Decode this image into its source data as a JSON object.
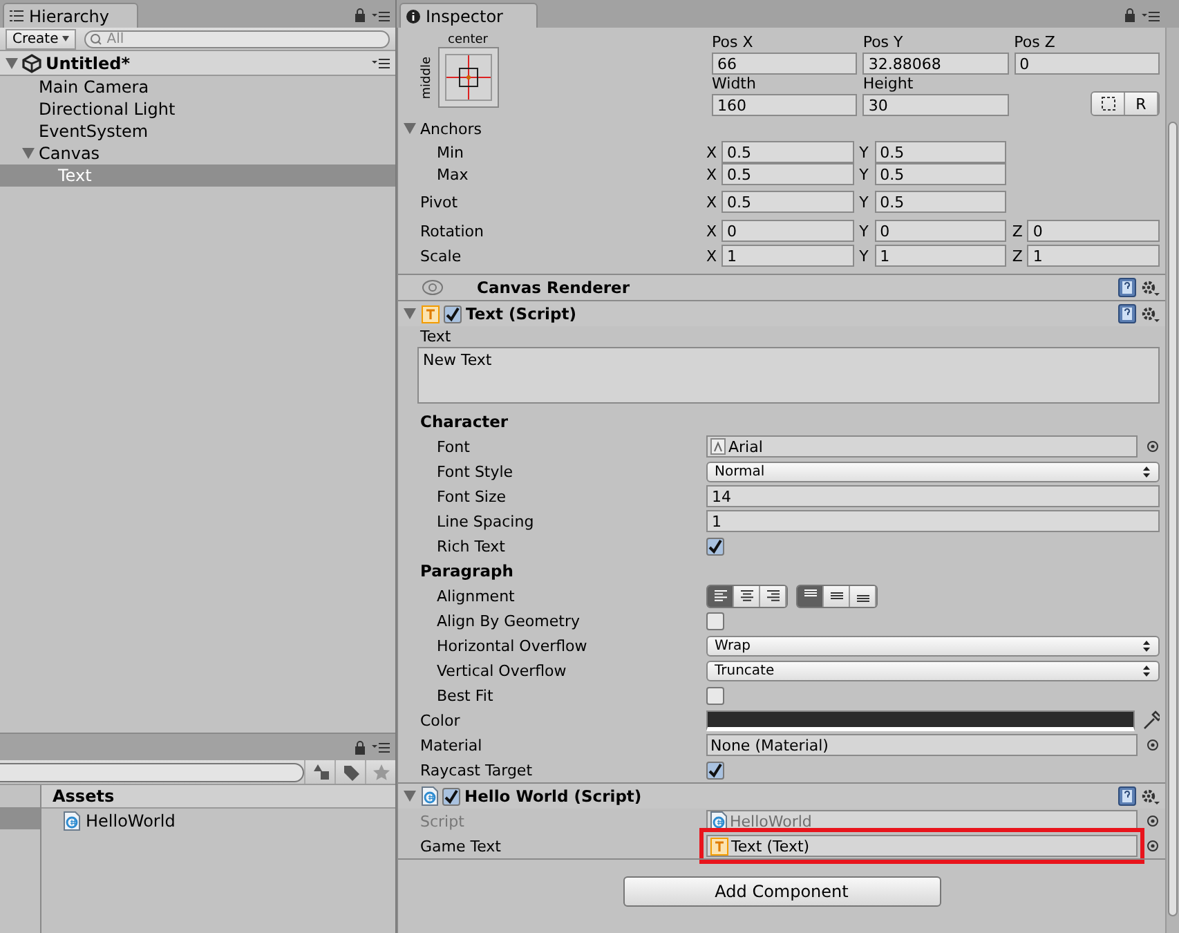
{
  "hierarchy": {
    "tab": "Hierarchy",
    "create_button": "Create",
    "search_placeholder": "All",
    "scene": {
      "name": "Untitled*",
      "expanded": true,
      "children": [
        {
          "name": "Main Camera",
          "selected": false
        },
        {
          "name": "Directional Light",
          "selected": false
        },
        {
          "name": "EventSystem",
          "selected": false
        },
        {
          "name": "Canvas",
          "selected": false,
          "expanded": true,
          "children": [
            {
              "name": "Text",
              "selected": true
            }
          ]
        }
      ]
    }
  },
  "project": {
    "folders": [
      {
        "selected": true
      }
    ],
    "header": "Assets",
    "items": [
      {
        "name": "HelloWorld"
      }
    ]
  },
  "inspector": {
    "tab": "Inspector",
    "rect_transform": {
      "anchor_horizontal": "center",
      "anchor_vertical": "middle",
      "top_fields": [
        {
          "label": "Pos X",
          "value": "66"
        },
        {
          "label": "Pos Y",
          "value": "32.88068"
        },
        {
          "label": "Pos Z",
          "value": "0"
        }
      ],
      "size_fields": [
        {
          "label": "Width",
          "value": "160"
        },
        {
          "label": "Height",
          "value": "30"
        }
      ],
      "reset_button": "R",
      "anchors": {
        "label": "Anchors",
        "expanded": true,
        "rows": [
          {
            "label": "Min",
            "fields": [
              {
                "axis": "X",
                "value": "0.5"
              },
              {
                "axis": "Y",
                "value": "0.5"
              }
            ]
          },
          {
            "label": "Max",
            "fields": [
              {
                "axis": "X",
                "value": "0.5"
              },
              {
                "axis": "Y",
                "value": "0.5"
              }
            ]
          }
        ]
      },
      "rows": [
        {
          "label": "Pivot",
          "fields": [
            {
              "axis": "X",
              "value": "0.5"
            },
            {
              "axis": "Y",
              "value": "0.5"
            }
          ]
        },
        {
          "label": "Rotation",
          "fields": [
            {
              "axis": "X",
              "value": "0"
            },
            {
              "axis": "Y",
              "value": "0"
            },
            {
              "axis": "Z",
              "value": "0"
            }
          ]
        },
        {
          "label": "Scale",
          "fields": [
            {
              "axis": "X",
              "value": "1"
            },
            {
              "axis": "Y",
              "value": "1"
            },
            {
              "axis": "Z",
              "value": "1"
            }
          ]
        }
      ]
    },
    "components": [
      {
        "kind": "canvas_renderer",
        "title": "Canvas Renderer"
      },
      {
        "kind": "text",
        "title": "Text (Script)",
        "expanded": true,
        "enabled": true,
        "text_label": "Text",
        "text_value": "New Text",
        "sections": [
          {
            "header": "Character",
            "properties": [
              {
                "kind": "font_ref",
                "label": "Font",
                "value": "Arial"
              },
              {
                "kind": "dropdown",
                "label": "Font Style",
                "value": "Normal"
              },
              {
                "kind": "field",
                "label": "Font Size",
                "value": "14"
              },
              {
                "kind": "field",
                "label": "Line Spacing",
                "value": "1"
              },
              {
                "kind": "checkbox",
                "label": "Rich Text",
                "checked": true
              }
            ]
          },
          {
            "header": "Paragraph",
            "properties": [
              {
                "kind": "alignment",
                "label": "Alignment",
                "horizontal": [
                  {
                    "selected": true
                  },
                  {
                    "selected": false
                  },
                  {
                    "selected": false
                  }
                ],
                "vertical": [
                  {
                    "selected": true
                  },
                  {
                    "selected": false
                  },
                  {
                    "selected": false
                  }
                ]
              },
              {
                "kind": "checkbox",
                "label": "Align By Geometry",
                "checked": false
              },
              {
                "kind": "dropdown",
                "label": "Horizontal Overflow",
                "value": "Wrap"
              },
              {
                "kind": "dropdown",
                "label": "Vertical Overflow",
                "value": "Truncate"
              },
              {
                "kind": "checkbox",
                "label": "Best Fit",
                "checked": false
              }
            ]
          }
        ],
        "properties": [
          {
            "kind": "color",
            "label": "Color",
            "color": "#2b2b2b"
          },
          {
            "kind": "asset_ref",
            "label": "Material",
            "value": "None (Material)"
          },
          {
            "kind": "checkbox",
            "label": "Raycast Target",
            "checked": true
          }
        ]
      },
      {
        "kind": "script",
        "title": "Hello World (Script)",
        "expanded": true,
        "enabled": true,
        "properties": [
          {
            "kind": "script_ref",
            "label": "Script",
            "value": "HelloWorld",
            "disabled": true
          },
          {
            "kind": "component_ref",
            "label": "Game Text",
            "value": "Text (Text)",
            "highlighted": true
          }
        ]
      }
    ],
    "add_component_button": "Add Component"
  }
}
